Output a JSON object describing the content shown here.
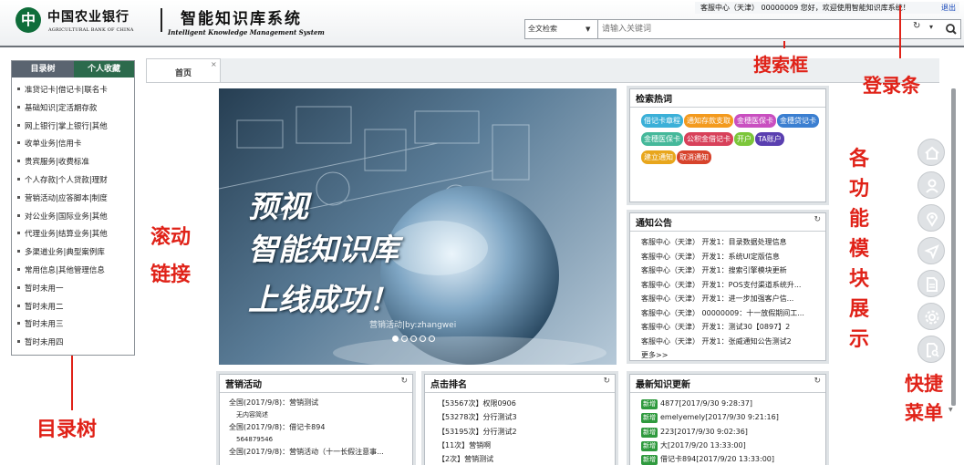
{
  "header": {
    "bank_mark": "中",
    "bank_name_cn": "中国农业银行",
    "bank_name_en": "AGRICULTURAL BANK OF CHINA",
    "system_name_cn": "智能知识库系统",
    "system_name_en": "Intelligent Knowledge Management System"
  },
  "login_bar": {
    "welcome": "客服中心（天津） 00000009 您好，欢迎使用智能知识库系统！",
    "logout_label": "退出"
  },
  "search": {
    "scope_value": "全文检索",
    "placeholder": "请输入关键词"
  },
  "annotations": {
    "search_box": "搜索框",
    "login_bar": "登录条",
    "modules": "各功能模块展示",
    "scroll_link_1": "滚动",
    "scroll_link_2": "链接",
    "directory_tree": "目录树",
    "quick_menu_1": "快捷",
    "quick_menu_2": "菜单"
  },
  "sidebar": {
    "tab_tree": "目录树",
    "tab_favorites": "个人收藏",
    "items": [
      "准贷记卡|借记卡|联名卡",
      "基础知识|定活期存款",
      "网上银行|掌上银行|其他",
      "收单业务|信用卡",
      "贵宾服务|收费标准",
      "个人存款|个人贷款|理财",
      "营销活动|应答脚本|制度",
      "对公业务|国际业务|其他",
      "代理业务|结算业务|其他",
      "多渠道业务|典型案例库",
      "常用信息|其他管理信息",
      "暂时未用一",
      "暂时未用二",
      "暂时未用三",
      "暂时未用四"
    ]
  },
  "tabs": {
    "home": "首页",
    "close_glyph": "×"
  },
  "banner": {
    "line1": "预视",
    "line2": "智能知识库",
    "line3": "上线成功！",
    "caption": "营销活动|by:zhangwei",
    "slide_count": 5,
    "active_slide": 1
  },
  "hot_search": {
    "title": "检索热词",
    "tags": [
      {
        "label": "借记卡章程",
        "color": "#3bb0d8"
      },
      {
        "label": "通知存款支取",
        "color": "#f39a1e"
      },
      {
        "label": "金穗医保卡",
        "color": "#c94fc0"
      },
      {
        "label": "金穗贷记卡",
        "color": "#3b7fd1"
      },
      {
        "label": "金穗医保卡",
        "color": "#45b89a"
      },
      {
        "label": "公积金借记卡",
        "color": "#d8415a"
      },
      {
        "label": "开户",
        "color": "#7cc63a"
      },
      {
        "label": "TA账户",
        "color": "#5a3fb0"
      },
      {
        "label": "建立通知",
        "color": "#e8a61c"
      },
      {
        "label": "取消通知",
        "color": "#d7432c"
      }
    ]
  },
  "notice": {
    "title": "通知公告",
    "items": [
      "客服中心（天津） 开发1：目录数据处理信息",
      "客服中心（天津） 开发1：系统UI定版信息",
      "客服中心（天津） 开发1：搜索引擎模块更新",
      "客服中心（天津） 开发1：POS支付渠道系统升...",
      "客服中心（天津） 开发1：进一步加强客户信...",
      "客服中心（天津） 00000009：十一放假期间工...",
      "客服中心（天津） 开发1：测试30【0897】2",
      "客服中心（天津） 开发1：张威通知公告测试2",
      "更多>>"
    ]
  },
  "activity": {
    "title": "营销活动",
    "items": [
      {
        "text": "全国(2017/9/8)：营销测试",
        "sub": false
      },
      {
        "text": "无内容简述",
        "sub": true
      },
      {
        "text": "全国(2017/9/8)：借记卡894",
        "sub": false
      },
      {
        "text": "564879546",
        "sub": true
      },
      {
        "text": "全国(2017/9/8)：营销活动（十一长假注意事...",
        "sub": false
      }
    ]
  },
  "rank": {
    "title": "点击排名",
    "items": [
      "【53567次】权限0906",
      "【53278次】分行测试3",
      "【53195次】分行测试2",
      "【11次】营销啊",
      "【2次】营销测试"
    ]
  },
  "latest": {
    "title": "最新知识更新",
    "badge": "新增",
    "items": [
      "4877[2017/9/30 9:28:37]",
      "emelyemely[2017/9/30 9:21:16]",
      "223[2017/9/30 9:02:36]",
      "大[2017/9/20 13:33:00]",
      "借记卡894[2017/9/20 13:33:00]"
    ]
  },
  "quick_menu": {
    "icons": [
      "home-icon",
      "user-icon",
      "location-icon",
      "navigate-icon",
      "document-icon",
      "settings-icon",
      "search-document-icon"
    ]
  }
}
